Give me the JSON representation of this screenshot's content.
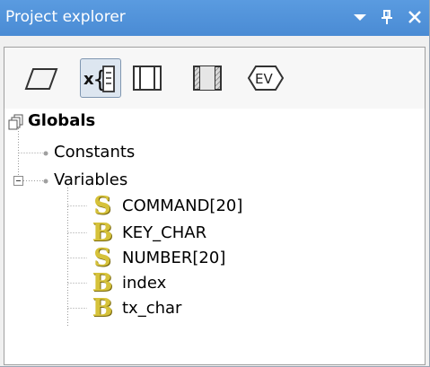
{
  "window": {
    "title": "Project explorer"
  },
  "toolbar": {
    "tools": [
      {
        "name": "parallelogram-icon",
        "active": false
      },
      {
        "name": "variables-icon",
        "active": true
      },
      {
        "name": "block-icon",
        "active": false
      },
      {
        "name": "hatched-block-icon",
        "active": false
      },
      {
        "name": "ev-icon",
        "active": false
      }
    ]
  },
  "tree": {
    "root": {
      "label": "Globals"
    },
    "groups": [
      {
        "label": "Constants",
        "expanded": false
      },
      {
        "label": "Variables",
        "expanded": true
      }
    ],
    "variables": [
      {
        "label": "COMMAND[20]",
        "type_icon": "S"
      },
      {
        "label": "KEY_CHAR",
        "type_icon": "B"
      },
      {
        "label": "NUMBER[20]",
        "type_icon": "S"
      },
      {
        "label": "index",
        "type_icon": "B"
      },
      {
        "label": "tx_char",
        "type_icon": "B"
      }
    ]
  },
  "colors": {
    "titlebar": "#4a8bd4",
    "type_icon": "#d6c23a"
  }
}
